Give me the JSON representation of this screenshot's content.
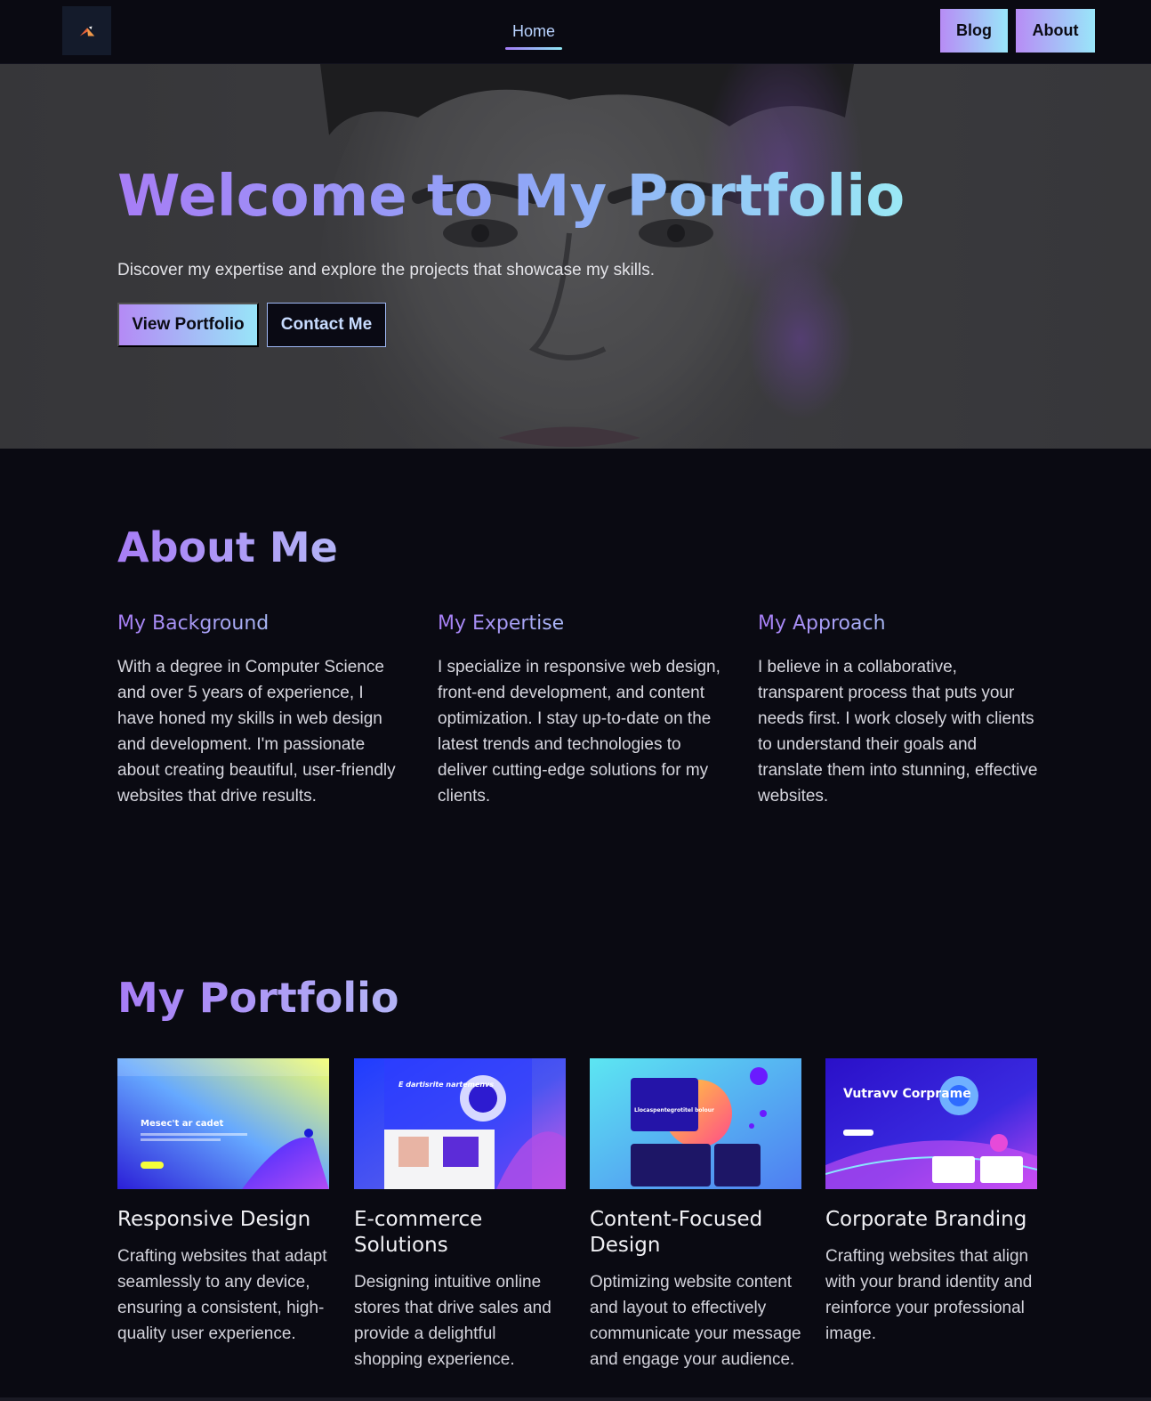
{
  "nav": {
    "logo_icon": "mountain-logo-icon",
    "home_label": "Home",
    "blog_label": "Blog",
    "about_label": "About"
  },
  "hero": {
    "title": "Welcome to My Portfolio",
    "subtitle": "Discover my expertise and explore the projects that showcase my skills.",
    "view_portfolio_label": "View Portfolio",
    "contact_label": "Contact Me"
  },
  "about": {
    "title": "About Me",
    "columns": [
      {
        "heading": "My Background",
        "text": "With a degree in Computer Science and over 5 years of experience, I have honed my skills in web design and development. I'm passionate about creating beautiful, user-friendly websites that drive results."
      },
      {
        "heading": "My Expertise",
        "text": "I specialize in responsive web design, front-end development, and content optimization. I stay up-to-date on the latest trends and technologies to deliver cutting-edge solutions for my clients."
      },
      {
        "heading": "My Approach",
        "text": "I believe in a collaborative, transparent process that puts your needs first. I work closely with clients to understand their goals and translate them into stunning, effective websites."
      }
    ]
  },
  "portfolio": {
    "title": "My Portfolio",
    "items": [
      {
        "title": "Responsive Design",
        "text": "Crafting websites that adapt seamlessly to any device, ensuring a consistent, high-quality user experience.",
        "thumb_text": "Mesec't ar cadet"
      },
      {
        "title": "E-commerce Solutions",
        "text": "Designing intuitive online stores that drive sales and provide a delightful shopping experience.",
        "thumb_text": "E dartisrite nartemenvs"
      },
      {
        "title": "Content-Focused Design",
        "text": "Optimizing website content and layout to effectively communicate your message and engage your audience.",
        "thumb_text": "Llocaspentegrotitel bolour"
      },
      {
        "title": "Corporate Branding",
        "text": "Crafting websites that align with your brand identity and reinforce your professional image.",
        "thumb_text": "Vutravv Corprame"
      }
    ]
  },
  "colors": {
    "background": "#0a0a12",
    "accent_purple": "#a77df6",
    "accent_cyan": "#99e6f9"
  }
}
